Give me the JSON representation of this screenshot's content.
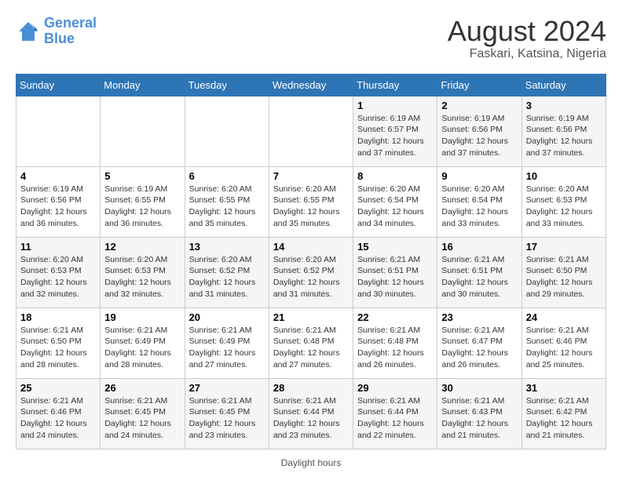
{
  "header": {
    "logo_line1": "General",
    "logo_line2": "Blue",
    "main_title": "August 2024",
    "subtitle": "Faskari, Katsina, Nigeria"
  },
  "days_of_week": [
    "Sunday",
    "Monday",
    "Tuesday",
    "Wednesday",
    "Thursday",
    "Friday",
    "Saturday"
  ],
  "weeks": [
    [
      {
        "num": "",
        "detail": ""
      },
      {
        "num": "",
        "detail": ""
      },
      {
        "num": "",
        "detail": ""
      },
      {
        "num": "",
        "detail": ""
      },
      {
        "num": "1",
        "detail": "Sunrise: 6:19 AM\nSunset: 6:57 PM\nDaylight: 12 hours\nand 37 minutes."
      },
      {
        "num": "2",
        "detail": "Sunrise: 6:19 AM\nSunset: 6:56 PM\nDaylight: 12 hours\nand 37 minutes."
      },
      {
        "num": "3",
        "detail": "Sunrise: 6:19 AM\nSunset: 6:56 PM\nDaylight: 12 hours\nand 37 minutes."
      }
    ],
    [
      {
        "num": "4",
        "detail": "Sunrise: 6:19 AM\nSunset: 6:56 PM\nDaylight: 12 hours\nand 36 minutes."
      },
      {
        "num": "5",
        "detail": "Sunrise: 6:19 AM\nSunset: 6:55 PM\nDaylight: 12 hours\nand 36 minutes."
      },
      {
        "num": "6",
        "detail": "Sunrise: 6:20 AM\nSunset: 6:55 PM\nDaylight: 12 hours\nand 35 minutes."
      },
      {
        "num": "7",
        "detail": "Sunrise: 6:20 AM\nSunset: 6:55 PM\nDaylight: 12 hours\nand 35 minutes."
      },
      {
        "num": "8",
        "detail": "Sunrise: 6:20 AM\nSunset: 6:54 PM\nDaylight: 12 hours\nand 34 minutes."
      },
      {
        "num": "9",
        "detail": "Sunrise: 6:20 AM\nSunset: 6:54 PM\nDaylight: 12 hours\nand 33 minutes."
      },
      {
        "num": "10",
        "detail": "Sunrise: 6:20 AM\nSunset: 6:53 PM\nDaylight: 12 hours\nand 33 minutes."
      }
    ],
    [
      {
        "num": "11",
        "detail": "Sunrise: 6:20 AM\nSunset: 6:53 PM\nDaylight: 12 hours\nand 32 minutes."
      },
      {
        "num": "12",
        "detail": "Sunrise: 6:20 AM\nSunset: 6:53 PM\nDaylight: 12 hours\nand 32 minutes."
      },
      {
        "num": "13",
        "detail": "Sunrise: 6:20 AM\nSunset: 6:52 PM\nDaylight: 12 hours\nand 31 minutes."
      },
      {
        "num": "14",
        "detail": "Sunrise: 6:20 AM\nSunset: 6:52 PM\nDaylight: 12 hours\nand 31 minutes."
      },
      {
        "num": "15",
        "detail": "Sunrise: 6:21 AM\nSunset: 6:51 PM\nDaylight: 12 hours\nand 30 minutes."
      },
      {
        "num": "16",
        "detail": "Sunrise: 6:21 AM\nSunset: 6:51 PM\nDaylight: 12 hours\nand 30 minutes."
      },
      {
        "num": "17",
        "detail": "Sunrise: 6:21 AM\nSunset: 6:50 PM\nDaylight: 12 hours\nand 29 minutes."
      }
    ],
    [
      {
        "num": "18",
        "detail": "Sunrise: 6:21 AM\nSunset: 6:50 PM\nDaylight: 12 hours\nand 28 minutes."
      },
      {
        "num": "19",
        "detail": "Sunrise: 6:21 AM\nSunset: 6:49 PM\nDaylight: 12 hours\nand 28 minutes."
      },
      {
        "num": "20",
        "detail": "Sunrise: 6:21 AM\nSunset: 6:49 PM\nDaylight: 12 hours\nand 27 minutes."
      },
      {
        "num": "21",
        "detail": "Sunrise: 6:21 AM\nSunset: 6:48 PM\nDaylight: 12 hours\nand 27 minutes."
      },
      {
        "num": "22",
        "detail": "Sunrise: 6:21 AM\nSunset: 6:48 PM\nDaylight: 12 hours\nand 26 minutes."
      },
      {
        "num": "23",
        "detail": "Sunrise: 6:21 AM\nSunset: 6:47 PM\nDaylight: 12 hours\nand 26 minutes."
      },
      {
        "num": "24",
        "detail": "Sunrise: 6:21 AM\nSunset: 6:46 PM\nDaylight: 12 hours\nand 25 minutes."
      }
    ],
    [
      {
        "num": "25",
        "detail": "Sunrise: 6:21 AM\nSunset: 6:46 PM\nDaylight: 12 hours\nand 24 minutes."
      },
      {
        "num": "26",
        "detail": "Sunrise: 6:21 AM\nSunset: 6:45 PM\nDaylight: 12 hours\nand 24 minutes."
      },
      {
        "num": "27",
        "detail": "Sunrise: 6:21 AM\nSunset: 6:45 PM\nDaylight: 12 hours\nand 23 minutes."
      },
      {
        "num": "28",
        "detail": "Sunrise: 6:21 AM\nSunset: 6:44 PM\nDaylight: 12 hours\nand 23 minutes."
      },
      {
        "num": "29",
        "detail": "Sunrise: 6:21 AM\nSunset: 6:44 PM\nDaylight: 12 hours\nand 22 minutes."
      },
      {
        "num": "30",
        "detail": "Sunrise: 6:21 AM\nSunset: 6:43 PM\nDaylight: 12 hours\nand 21 minutes."
      },
      {
        "num": "31",
        "detail": "Sunrise: 6:21 AM\nSunset: 6:42 PM\nDaylight: 12 hours\nand 21 minutes."
      }
    ]
  ],
  "footer": {
    "daylight_label": "Daylight hours"
  }
}
